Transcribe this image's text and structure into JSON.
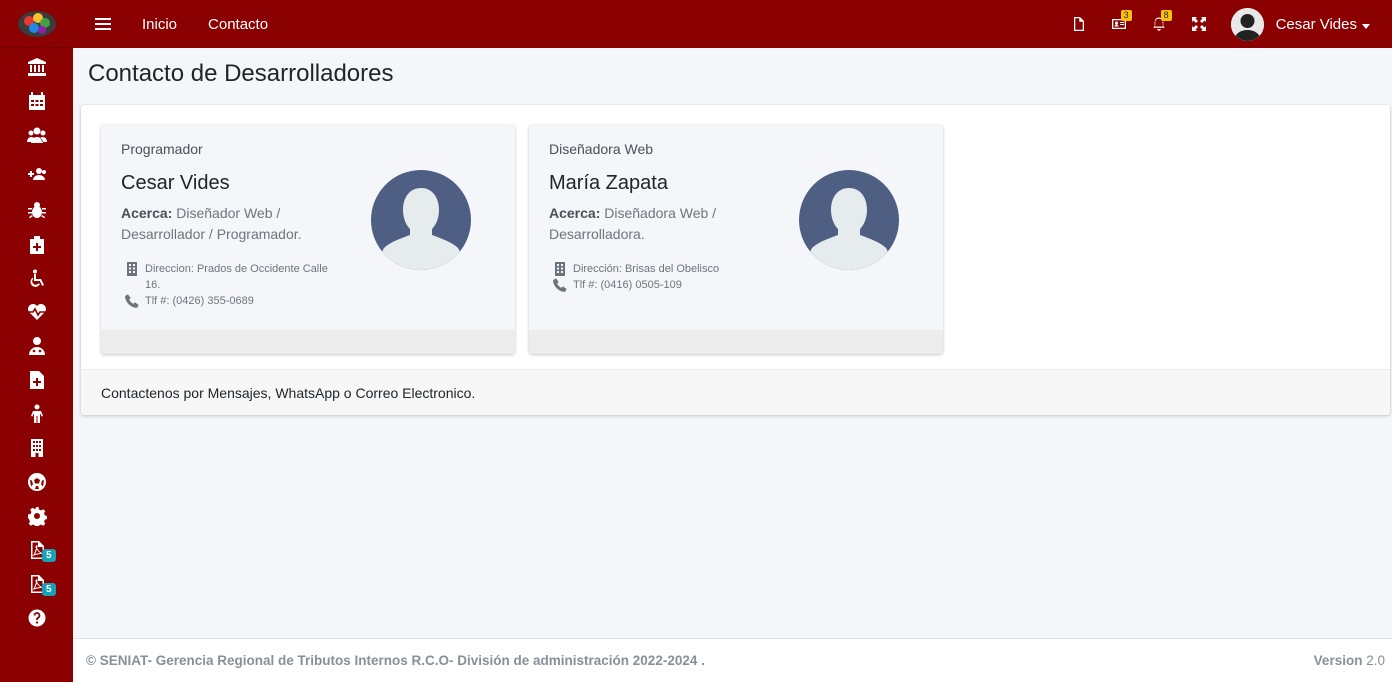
{
  "topbar": {
    "nav_links": [
      "Inicio",
      "Contacto"
    ],
    "icons": [
      {
        "name": "file-icon",
        "badge": ""
      },
      {
        "name": "id-card-icon",
        "badge": "3"
      },
      {
        "name": "bell-icon",
        "badge": "8"
      },
      {
        "name": "expand-icon",
        "badge": ""
      }
    ],
    "user_name": "Cesar Vides"
  },
  "sidebar": {
    "items": [
      {
        "icon": "bank-icon",
        "badge": ""
      },
      {
        "icon": "calendar-icon",
        "badge": ""
      },
      {
        "icon": "users-icon",
        "badge": ""
      },
      {
        "icon": "user-plus-icon",
        "badge": ""
      },
      {
        "icon": "bug-icon",
        "badge": ""
      },
      {
        "icon": "medkit-icon",
        "badge": ""
      },
      {
        "icon": "wheelchair-icon",
        "badge": ""
      },
      {
        "icon": "heartbeat-icon",
        "badge": ""
      },
      {
        "icon": "user-md-icon",
        "badge": ""
      },
      {
        "icon": "file-medical-icon",
        "badge": ""
      },
      {
        "icon": "child-icon",
        "badge": ""
      },
      {
        "icon": "building-icon",
        "badge": ""
      },
      {
        "icon": "futbol-icon",
        "badge": ""
      },
      {
        "icon": "gear-icon",
        "badge": ""
      },
      {
        "icon": "pdf-icon",
        "badge": "5"
      },
      {
        "icon": "pdf-icon",
        "badge": "5"
      },
      {
        "icon": "question-icon",
        "badge": ""
      }
    ]
  },
  "page": {
    "title": "Contacto de Desarrolladores",
    "developers": [
      {
        "role": "Programador",
        "name": "Cesar Vides",
        "about_label": "Acerca:",
        "about_text": "Diseñador Web / Desarrollador / Programador.",
        "address": "Direccion: Prados de Occidente Calle 16.",
        "phone": "Tlf #: (0426) 355-0689"
      },
      {
        "role": "Diseñadora Web",
        "name": "María Zapata",
        "about_label": "Acerca:",
        "about_text": "Diseñadora Web / Desarrolladora.",
        "address": "Dirección: Brisas del Obelisco",
        "phone": "Tlf #: (0416) 0505-109"
      }
    ],
    "card_footer": "Contactenos por Mensajes, WhatsApp o Correo Electronico."
  },
  "footer": {
    "copyright": "© SENIAT- Gerencia Regional de Tributos Internos R.C.O- División de administración 2022-2024 .",
    "version_label": "Version",
    "version_value": "2.0"
  },
  "colors": {
    "brand": "#8b0000",
    "avatar": "#4f5f84",
    "badge_info": "#17a2b8",
    "badge_warning": "#ffc107"
  }
}
